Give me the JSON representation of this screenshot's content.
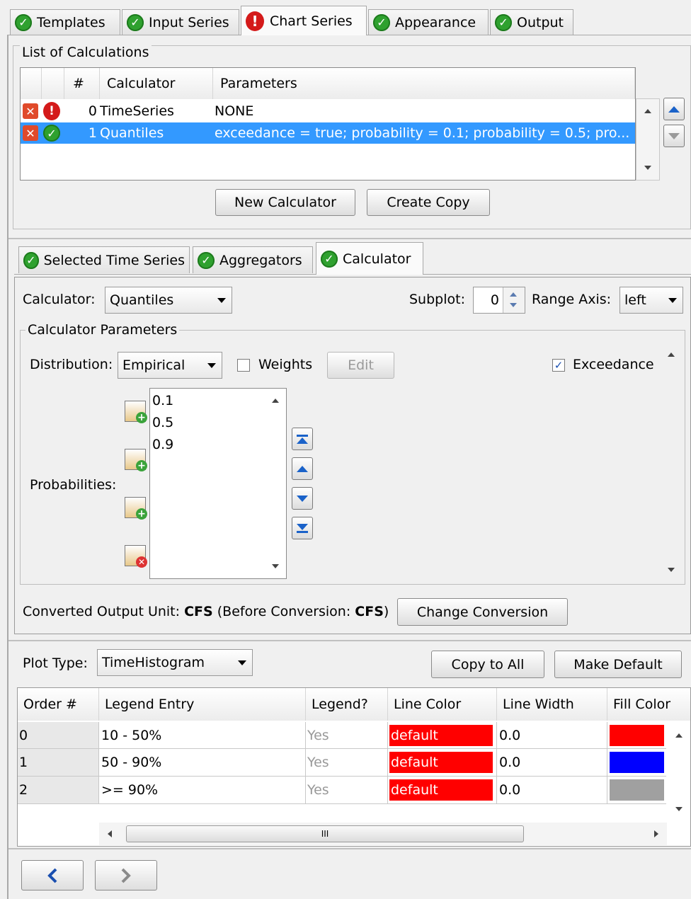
{
  "top_tabs": [
    {
      "label": "Templates",
      "status": "ok"
    },
    {
      "label": "Input Series",
      "status": "ok"
    },
    {
      "label": "Chart Series",
      "status": "error"
    },
    {
      "label": "Appearance",
      "status": "ok"
    },
    {
      "label": "Output",
      "status": "ok"
    }
  ],
  "calc_list": {
    "title": "List of Calculations",
    "columns": [
      "#",
      "Calculator",
      "Parameters"
    ],
    "rows": [
      {
        "num": "0",
        "calculator": "TimeSeries",
        "parameters": "NONE",
        "status": "error"
      },
      {
        "num": "1",
        "calculator": "Quantiles",
        "parameters": "exceedance = true; probability = 0.1; probability = 0.5; pro...",
        "status": "ok",
        "selected": true
      }
    ],
    "new_calculator": "New Calculator",
    "create_copy": "Create Copy"
  },
  "sub_tabs": [
    {
      "label": "Selected Time Series",
      "status": "ok"
    },
    {
      "label": "Aggregators",
      "status": "ok"
    },
    {
      "label": "Calculator",
      "status": "ok"
    }
  ],
  "calculator": {
    "label": "Calculator:",
    "value": "Quantiles",
    "subplot_label": "Subplot:",
    "subplot_value": "0",
    "range_axis_label": "Range Axis:",
    "range_axis_value": "left"
  },
  "params": {
    "title": "Calculator Parameters",
    "distribution_label": "Distribution:",
    "distribution_value": "Empirical",
    "weights_label": "Weights",
    "weights_checked": false,
    "edit_label": "Edit",
    "exceedance_label": "Exceedance",
    "exceedance_checked": true,
    "probabilities_label": "Probabilities:",
    "probabilities": [
      "0.1",
      "0.5",
      "0.9"
    ]
  },
  "conversion": {
    "prefix": "Converted Output Unit:",
    "unit": "CFS",
    "before_prefix": "(Before Conversion:",
    "before_unit": "CFS",
    "before_suffix": ")",
    "button": "Change Conversion"
  },
  "plot": {
    "label": "Plot Type:",
    "value": "TimeHistogram",
    "copy_to_all": "Copy to All",
    "make_default": "Make Default",
    "columns": [
      "Order #",
      "Legend Entry",
      "Legend?",
      "Line Color",
      "Line Width",
      "Fill Color"
    ],
    "rows": [
      {
        "order": "0",
        "legend": "10 - 50%",
        "show": "Yes",
        "line_color": "default",
        "line_width": "0.0",
        "fill": "#ff0000"
      },
      {
        "order": "1",
        "legend": "50 - 90%",
        "show": "Yes",
        "line_color": "default",
        "line_width": "0.0",
        "fill": "#0000ff"
      },
      {
        "order": "2",
        "legend": ">= 90%",
        "show": "Yes",
        "line_color": "default",
        "line_width": "0.0",
        "fill": "#a0a0a0"
      }
    ],
    "hscroll_grip": "III"
  },
  "nav": {
    "back_icon": "chevron-left-icon",
    "forward_icon": "chevron-right-icon"
  },
  "colors": {
    "selection": "#3399ff",
    "line_color_cell": "#ff0000",
    "ok": "#2fa12f",
    "error": "#d41a1a"
  }
}
